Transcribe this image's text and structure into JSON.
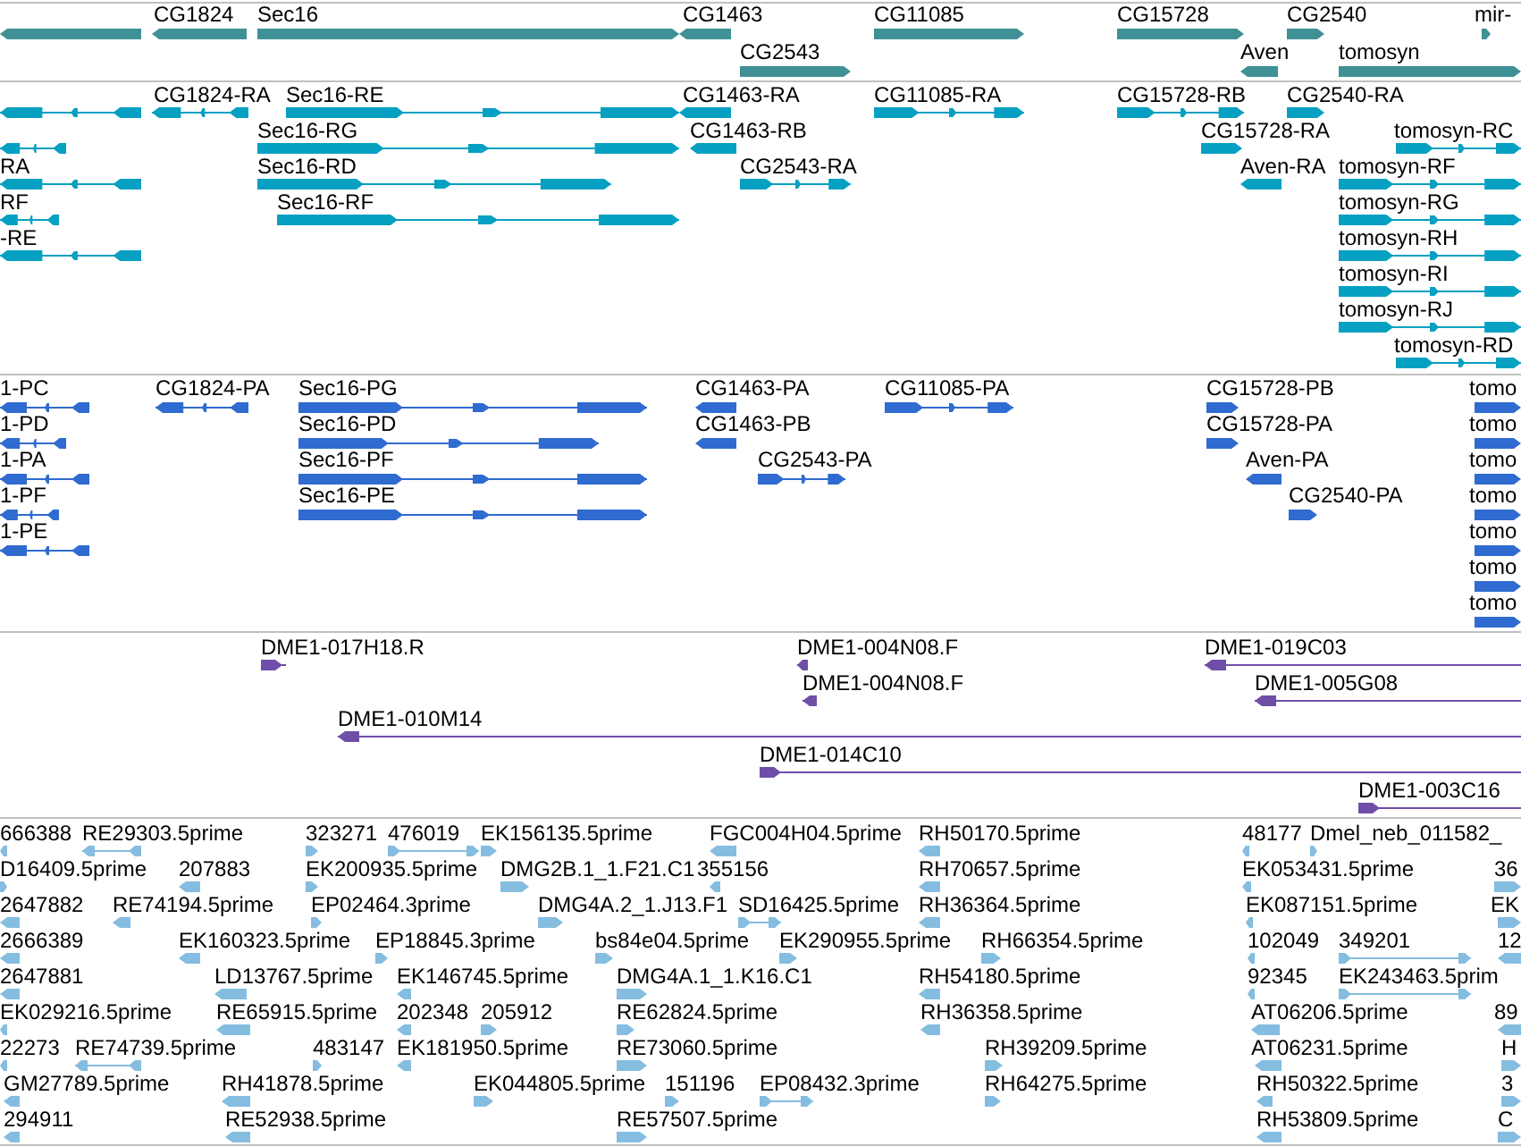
{
  "tracks": [
    {
      "kind": "gene",
      "color": "#3f9195",
      "labels": [
        "CG1824",
        "Sec16",
        "CG1463",
        "CG2543",
        "CG11085",
        "CG15728",
        "CG2540",
        "mir-",
        "Aven",
        "tomosyn"
      ]
    },
    {
      "kind": "transcript",
      "color": "#06a0c2",
      "labels": [
        "RA",
        "RF",
        "-RE",
        "CG1824-RA",
        "Sec16-RE",
        "Sec16-RG",
        "Sec16-RD",
        "Sec16-RF",
        "CG1463-RA",
        "CG1463-RB",
        "CG2543-RA",
        "CG11085-RA",
        "CG15728-RB",
        "CG15728-RA",
        "CG2540-RA",
        "Aven-RA",
        "tomosyn-RC",
        "tomosyn-RF",
        "tomosyn-RG",
        "tomosyn-RH",
        "tomosyn-RI",
        "tomosyn-RJ",
        "tomosyn-RD"
      ]
    },
    {
      "kind": "transcript",
      "color": "#2f6bd0",
      "labels": [
        "1-PC",
        "1-PD",
        "1-PA",
        "1-PF",
        "1-PE",
        "CG1824-PA",
        "Sec16-PG",
        "Sec16-PD",
        "Sec16-PF",
        "Sec16-PE",
        "CG1463-PA",
        "CG1463-PB",
        "CG2543-PA",
        "CG11085-PA",
        "CG15728-PB",
        "CG15728-PA",
        "Aven-PA",
        "CG2540-PA",
        "tomo",
        "tomo",
        "tomo",
        "tomo",
        "tomo",
        "tomo",
        "tomo"
      ]
    },
    {
      "kind": "clone",
      "color": "#6f4ea8",
      "labels": [
        "DME1-017H18.R",
        "DME1-010M14",
        "DME1-004N08.F",
        "DME1-004N08.F",
        "DME1-014C10",
        "DME1-019C03",
        "DME1-005G08",
        "DME1-003C16"
      ]
    },
    {
      "kind": "est",
      "color": "#84bde0",
      "labels": [
        "666388",
        "RE29303.5prime",
        "323271",
        "476019",
        "EK156135.5prime",
        "FGC004H04.5prime",
        "RH50170.5prime",
        "48177",
        "Dmel_neb_011582_",
        "D16409.5prime",
        "207883",
        "EK200935.5prime",
        "DMG2B.1_1.F21.C1",
        "355156",
        "RH70657.5prime",
        "EK053431.5prime",
        "36",
        "2647882",
        "RE74194.5prime",
        "EP02464.3prime",
        "DMG4A.2_1.J13.F1",
        "SD16425.5prime",
        "RH36364.5prime",
        "EK087151.5prime",
        "EK",
        "2666389",
        "EK160323.5prime",
        "EP18845.3prime",
        "bs84e04.5prime",
        "EK290955.5prime",
        "RH66354.5prime",
        "102049",
        "349201",
        "12",
        "2647881",
        "LD13767.5prime",
        "EK146745.5prime",
        "DMG4A.1_1.K16.C1",
        "RH54180.5prime",
        "92345",
        "EK243463.5prim",
        "EK029216.5prime",
        "RE65915.5prime",
        "202348",
        "205912",
        "RE62824.5prime",
        "RH36358.5prime",
        "AT06206.5prime",
        "89",
        "22273",
        "RE74739.5prime",
        "483147",
        "EK181950.5prime",
        "RE73060.5prime",
        "RH39209.5prime",
        "AT06231.5prime",
        "H",
        "GM27789.5prime",
        "RH41878.5prime",
        "EK044805.5prime",
        "151196",
        "EP08432.3prime",
        "RH64275.5prime",
        "RH50322.5prime",
        "3",
        "294911",
        "RE52938.5prime",
        "RE57507.5prime",
        "RH53809.5prime",
        "C"
      ]
    }
  ]
}
